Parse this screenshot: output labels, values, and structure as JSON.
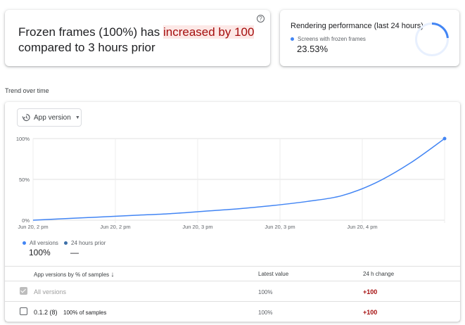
{
  "insight": {
    "prefix": "Frozen frames (100%) has ",
    "highlight": "increased by 100",
    "suffix": " compared to 3 hours prior",
    "help_icon": "?"
  },
  "performance": {
    "title": "Rendering performance (last 24 hours)",
    "legend": "Screens with frozen frames",
    "value": "23.53%",
    "ring_fraction": 0.2353,
    "accent": "#4285f4"
  },
  "trend": {
    "label": "Trend over time",
    "selector": {
      "label": "App version",
      "icon": "history-icon"
    }
  },
  "chart_data": {
    "type": "line",
    "y_ticks": [
      "100%",
      "50%",
      "0%"
    ],
    "x_ticks": [
      "Jun 20, 2 pm",
      "Jun 20, 2 pm",
      "Jun 20, 3 pm",
      "Jun 20, 3 pm",
      "Jun 20, 4 pm"
    ],
    "ylim": [
      0,
      100
    ],
    "x": [
      0,
      1,
      2,
      3,
      4,
      5,
      6,
      7,
      8,
      9,
      10,
      11,
      12
    ],
    "series": [
      {
        "name": "All versions",
        "color": "#4285f4",
        "values": [
          0,
          2,
          4,
          6,
          8,
          11,
          14,
          18,
          23,
          30,
          46,
          70,
          100
        ]
      }
    ],
    "grid": true
  },
  "legend": {
    "current_label": "All versions",
    "current_value": "100%",
    "current_color": "#4285f4",
    "prior_label": "24 hours prior",
    "prior_value": "—",
    "prior_color": "#3c6fa8"
  },
  "table": {
    "headers": [
      "App versions by % of samples",
      "Latest value",
      "24 h change"
    ],
    "sort_icon": "↓",
    "rows": [
      {
        "name": "All versions",
        "note": "",
        "latest": "100%",
        "change": "+100",
        "checked": true
      },
      {
        "name": "0.1.2 (8)",
        "note": "100% of samples",
        "latest": "100%",
        "change": "+100",
        "checked": false
      }
    ]
  }
}
